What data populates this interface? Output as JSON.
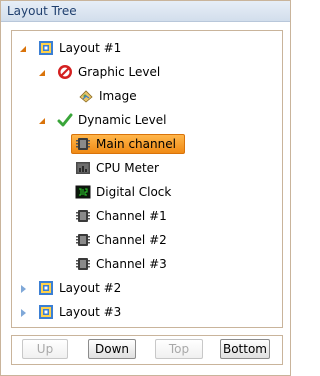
{
  "header": {
    "title": "Layout Tree"
  },
  "tree": {
    "layout1": "Layout #1",
    "graphic_level": "Graphic Level",
    "image": "Image",
    "dynamic_level": "Dynamic Level",
    "main_channel": "Main channel",
    "cpu_meter": "CPU Meter",
    "digital_clock": "Digital Clock",
    "channel1": "Channel #1",
    "channel2": "Channel #2",
    "channel3": "Channel #3",
    "layout2": "Layout #2",
    "layout3": "Layout #3"
  },
  "buttons": {
    "up": "Up",
    "down": "Down",
    "top": "Top",
    "bottom": "Bottom"
  },
  "colors": {
    "selection": "#f5a030",
    "expander_open": "#d9730a",
    "expander_closed": "#7fa8d8"
  }
}
